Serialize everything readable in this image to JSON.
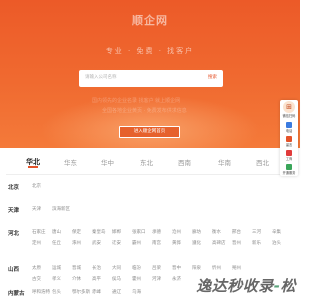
{
  "hero": {
    "logo_text": "顺企网",
    "slogan": "专业 · 免费 · 找客户",
    "search_placeholder": "请输入公司名称",
    "search_button": "搜索",
    "hint_line_1": "国内领先的企业名录 找客户 就上顺企网",
    "hint_line_2": "全国各地企业黄页 · 免费发布供求信息",
    "enter_button": "进入顺企网首页"
  },
  "tabs": {
    "items": [
      "华北",
      "华东",
      "华中",
      "东北",
      "西南",
      "华南",
      "西北"
    ],
    "active_index": 0
  },
  "regions": [
    {
      "province": "北京",
      "cities": [
        "北京"
      ]
    },
    {
      "province": "天津",
      "cities": [
        "天津",
        "滨海新区"
      ]
    },
    {
      "province": "河北",
      "cities": [
        "石家庄",
        "唐山",
        "保定",
        "秦皇岛",
        "邯郸",
        "张家口",
        "承德",
        "沧州",
        "廊坊",
        "衡水",
        "邢台",
        "三河",
        "辛集"
      ]
    },
    {
      "province": "",
      "cities": [
        "定州",
        "任丘",
        "涿州",
        "武安",
        "迁安",
        "霸州",
        "南宫",
        "黄骅",
        "遵化",
        "高碑店",
        "晋州",
        "新乐",
        "泊头"
      ]
    },
    {
      "province": "山西",
      "cities": [
        "太原",
        "运城",
        "晋城",
        "长治",
        "大同",
        "临汾",
        "吕梁",
        "晋中",
        "阳泉",
        "忻州",
        "朔州"
      ]
    },
    {
      "province": "",
      "cities": [
        "古交",
        "孝义",
        "介休",
        "高平",
        "侯马",
        "霍州",
        "河津",
        "永济"
      ]
    },
    {
      "province": "内蒙古",
      "cities": [
        "呼和浩特",
        "包头",
        "鄂尔多斯",
        "赤峰",
        "通辽",
        "乌海"
      ]
    }
  ],
  "sidebar": {
    "top_label": "微信扫码",
    "items": [
      "电话",
      "留言",
      "工商",
      "开通服务"
    ]
  },
  "watermark": {
    "text_a": "逸达秒收录",
    "text_b": "-",
    "text_c": "松"
  },
  "colors": {
    "brand": "#e4532a",
    "hero_gradient_top": "#ec5a28",
    "hero_gradient_bottom": "#f47a3a",
    "active_tab": "#222222",
    "city_text": "#8c8c8c"
  }
}
